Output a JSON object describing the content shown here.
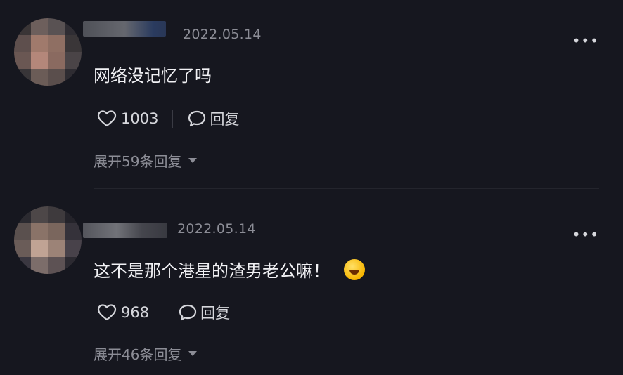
{
  "comments": [
    {
      "date": "2022.05.14",
      "text": "网络没记忆了吗",
      "likes": "1003",
      "reply_label": "回复",
      "expand_label": "展开59条回复",
      "more_label": "•••"
    },
    {
      "date": "2022.05.14",
      "text": "这不是那个港星的渣男老公嘛！",
      "likes": "968",
      "reply_label": "回复",
      "expand_label": "展开46条回复",
      "more_label": "•••",
      "emoji": "laughing-tears-emoji"
    }
  ],
  "colors": {
    "background": "#16171f",
    "text_primary": "#f1f1f4",
    "text_secondary": "#8c8d96"
  },
  "icons": [
    "heart-icon",
    "comment-bubble-icon",
    "more-options-icon",
    "caret-down-icon"
  ]
}
